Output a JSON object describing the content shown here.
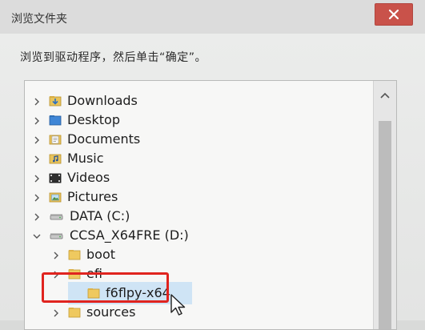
{
  "dialog": {
    "title": "浏览文件夹",
    "instruction": "浏览到驱动程序，然后单击“确定”。"
  },
  "tree": {
    "items": [
      {
        "label": "Downloads",
        "icon": "downloads-folder-icon",
        "expand": "collapsed"
      },
      {
        "label": "Desktop",
        "icon": "desktop-folder-icon",
        "expand": "collapsed"
      },
      {
        "label": "Documents",
        "icon": "documents-folder-icon",
        "expand": "collapsed"
      },
      {
        "label": "Music",
        "icon": "music-folder-icon",
        "expand": "collapsed"
      },
      {
        "label": "Videos",
        "icon": "videos-folder-icon",
        "expand": "collapsed"
      },
      {
        "label": "Pictures",
        "icon": "pictures-folder-icon",
        "expand": "collapsed"
      },
      {
        "label": "DATA (C:)",
        "icon": "drive-icon",
        "expand": "collapsed"
      },
      {
        "label": "CCSA_X64FRE (D:)",
        "icon": "drive-icon",
        "expand": "expanded"
      },
      {
        "label": "boot",
        "icon": "folder-icon",
        "expand": "collapsed"
      },
      {
        "label": "efi",
        "icon": "folder-icon",
        "expand": "collapsed"
      },
      {
        "label": "f6flpy-x64",
        "icon": "folder-icon",
        "expand": "none",
        "selected": true
      },
      {
        "label": "sources",
        "icon": "folder-icon",
        "expand": "collapsed"
      }
    ]
  },
  "colors": {
    "selection": "#cfe4f5",
    "highlight": "#e0241f",
    "close": "#c9524a"
  }
}
